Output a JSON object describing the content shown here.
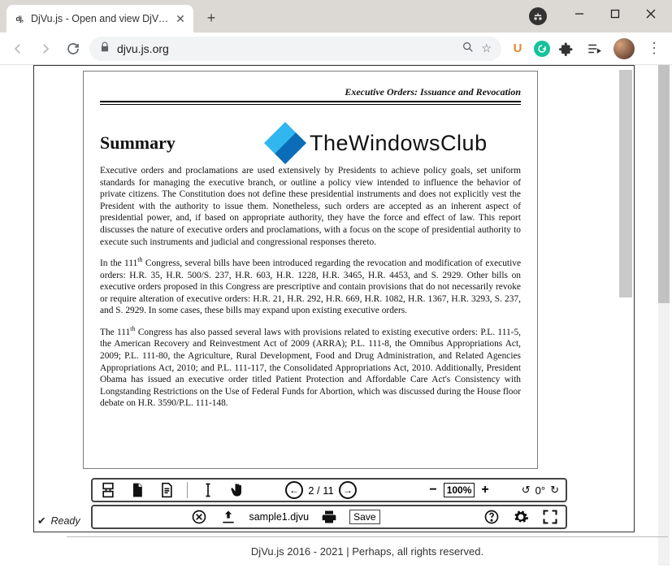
{
  "browser": {
    "tab_title": "DjVu.js - Open and view DjVu on",
    "url_display": "djvu.js.org",
    "ext_u_label": "U"
  },
  "viewer": {
    "status_text": "Ready",
    "file_name": "sample1.djvu",
    "save_label": "Save",
    "page_current": "2",
    "page_total": "11",
    "zoom_value": "100%",
    "rotation": "0°"
  },
  "watermark": {
    "text": "TheWindowsClub"
  },
  "document": {
    "header_right": "Executive Orders: Issuance and Revocation",
    "heading": "Summary",
    "p1": "Executive orders and proclamations are used extensively by Presidents to achieve policy goals, set uniform standards for managing the executive branch, or outline a policy view intended to influence the behavior of private citizens. The Constitution does not define these presidential instruments and does not explicitly vest the President with the authority to issue them. Nonetheless, such orders are accepted as an inherent aspect of presidential power, and, if based on appropriate authority, they have the force and effect of law. This report discusses the nature of executive orders and proclamations, with a focus on the scope of presidential authority to execute such instruments and judicial and congressional responses thereto.",
    "p2a": "In the 111",
    "p2b": " Congress, several bills have been introduced regarding the revocation and modification of executive orders: H.R. 35, H.R. 500/S. 237, H.R. 603, H.R. 1228, H.R. 3465, H.R. 4453, and S. 2929. Other bills on executive orders proposed in this Congress are prescriptive and contain provisions that do not necessarily revoke or require alteration of executive orders: H.R. 21, H.R. 292, H.R. 669, H.R. 1082, H.R. 1367, H.R. 3293, S. 237, and S. 2929. In some cases, these bills may expand upon existing executive orders.",
    "p3a": "The 111",
    "p3b": " Congress has also passed several laws with provisions related to existing executive orders: P.L. 111-5, the American Recovery and Reinvestment Act of 2009 (ARRA); P.L. 111-8, the Omnibus Appropriations Act, 2009; P.L. 111-80, the Agriculture, Rural Development, Food and Drug Administration, and Related Agencies Appropriations Act, 2010; and P.L. 111-117, the Consolidated Appropriations Act, 2010. Additionally, President Obama has issued an executive order titled Patient Protection and Affordable Care Act's Consistency with Longstanding Restrictions on the Use of Federal Funds for Abortion, which was discussed during the House floor debate on H.R. 3590/P.L. 111-148.",
    "sup_th": "th"
  },
  "footer": {
    "text": "DjVu.js 2016 - 2021 | Perhaps, all rights reserved."
  }
}
